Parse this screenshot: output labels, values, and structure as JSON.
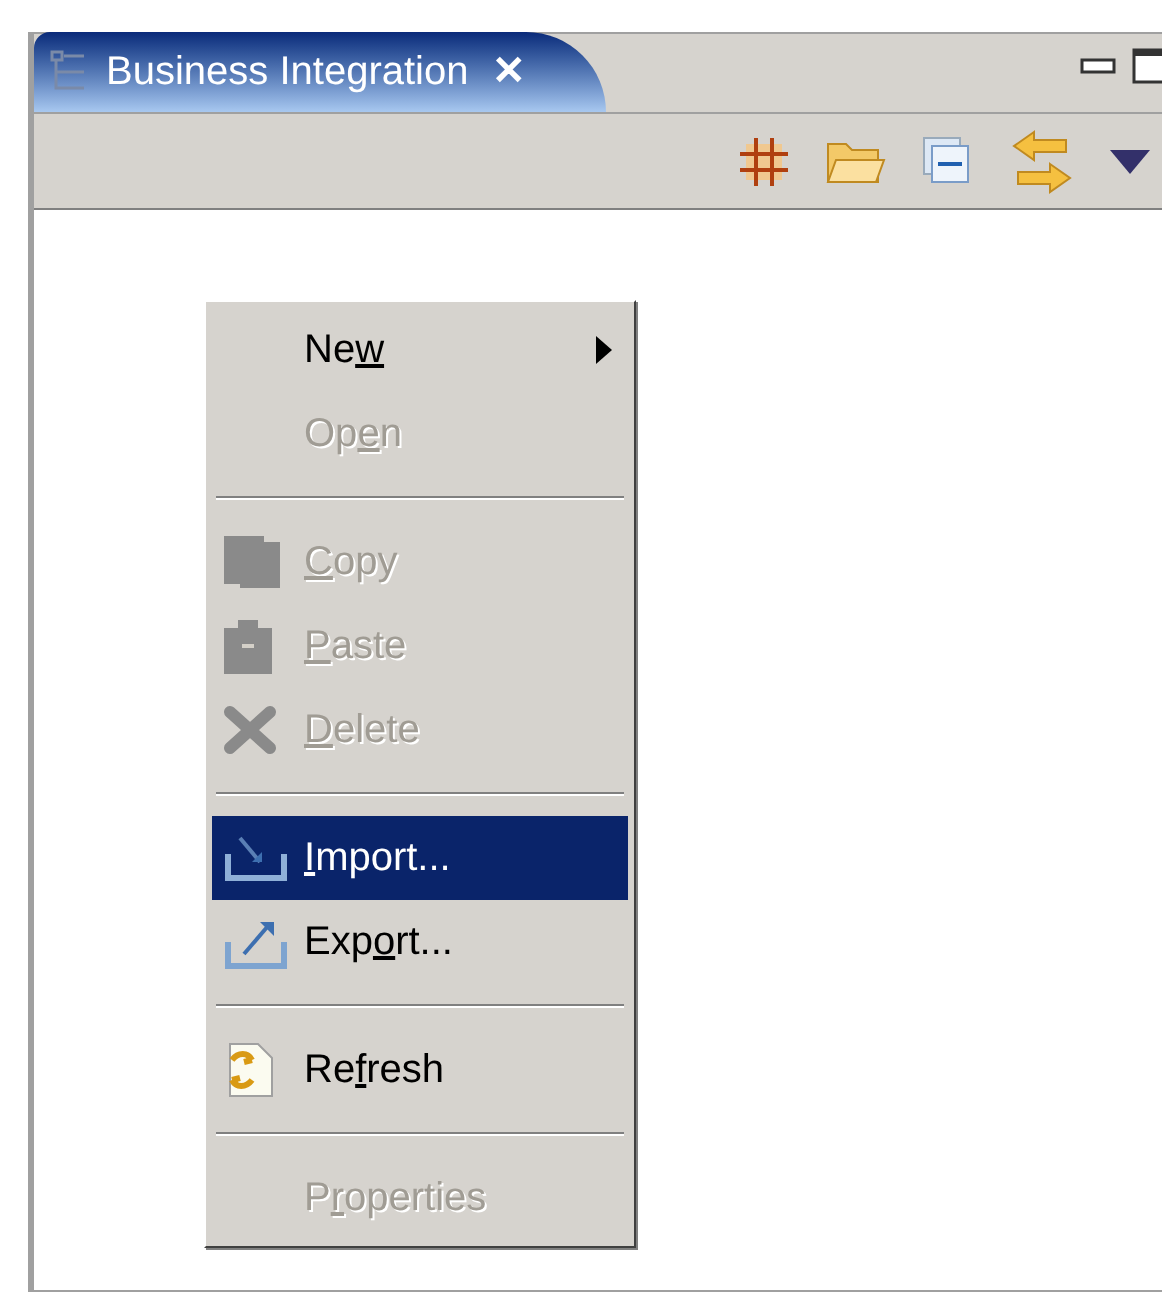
{
  "tab": {
    "title": "Business Integration",
    "close": "✕",
    "selected": true
  },
  "menu": {
    "items": [
      {
        "kind": "item",
        "before": "Ne",
        "underlined": "w",
        "disabled": false,
        "selected": false,
        "submenu": true
      },
      {
        "kind": "item",
        "before": "Op",
        "underlined": "e",
        "after": "n",
        "disabled": true,
        "selected": false,
        "submenu": false
      },
      {
        "kind": "separator"
      },
      {
        "kind": "item",
        "underlined": "C",
        "after": "opy",
        "disabled": true,
        "selected": false,
        "submenu": false
      },
      {
        "kind": "item",
        "underlined": "P",
        "after": "aste",
        "disabled": true,
        "selected": false,
        "submenu": false
      },
      {
        "kind": "item",
        "underlined": "D",
        "after": "elete",
        "disabled": true,
        "selected": false,
        "submenu": false
      },
      {
        "kind": "separator"
      },
      {
        "kind": "item",
        "underlined": "I",
        "after": "mport...",
        "disabled": false,
        "selected": true,
        "submenu": false
      },
      {
        "kind": "item",
        "before": "Exp",
        "underlined": "o",
        "after": "rt...",
        "disabled": false,
        "selected": false,
        "submenu": false
      },
      {
        "kind": "separator"
      },
      {
        "kind": "item",
        "before": "Re",
        "underlined": "f",
        "after": "resh",
        "disabled": false,
        "selected": false,
        "submenu": false
      },
      {
        "kind": "separator"
      },
      {
        "kind": "item",
        "before": "P",
        "underlined": "r",
        "after": "operties",
        "disabled": true,
        "selected": false,
        "submenu": false
      }
    ]
  }
}
